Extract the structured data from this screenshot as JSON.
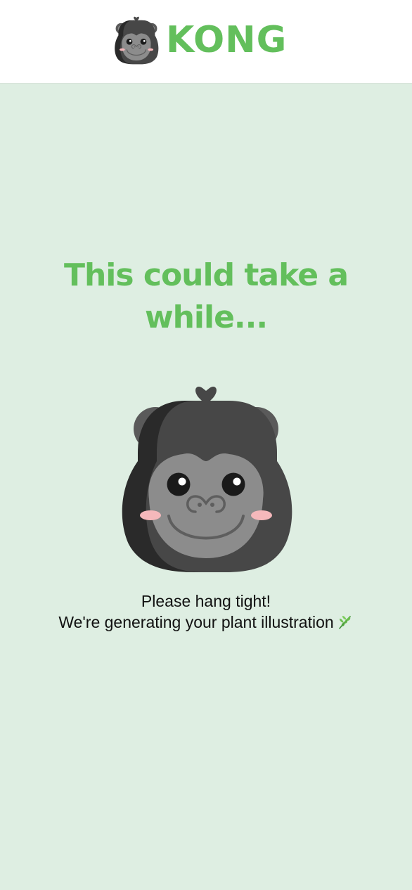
{
  "header": {
    "brand_name": "KONG",
    "logo_icon": "gorilla-face-icon"
  },
  "main": {
    "headline_line1": "This could take a",
    "headline_line2": "while...",
    "mascot_icon": "gorilla-face-icon",
    "message_line1": "Please hang tight!",
    "message_line2": "We're generating your plant illustration",
    "message_emoji_icon": "herb-leaf-icon"
  },
  "colors": {
    "background": "#deeee2",
    "brand_green": "#63bf5c",
    "header_background": "#ffffff",
    "text": "#111111"
  }
}
